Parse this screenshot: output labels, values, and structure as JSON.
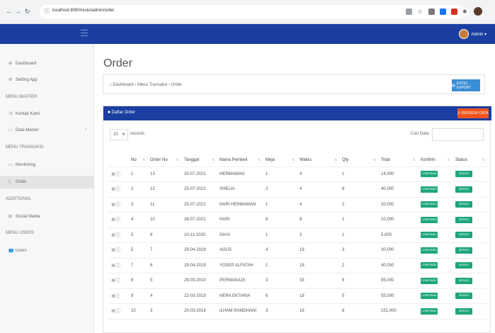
{
  "browser": {
    "url": "localhost:8080/resto/admin/order"
  },
  "header": {
    "user_label": "Admin ▾"
  },
  "sidebar": {
    "items": [
      {
        "label": "Dashboard",
        "icon": "dashboard-icon",
        "glyph": "⊕"
      },
      {
        "label": "Setting App",
        "icon": "gear-icon",
        "glyph": "⚙"
      }
    ],
    "master_heading": "MENU MASTER",
    "master_items": [
      {
        "label": "Kontak Kami",
        "icon": "phone-icon",
        "glyph": "☏"
      },
      {
        "label": "Data Master",
        "icon": "folder-icon",
        "glyph": "▭",
        "chevron": "‹"
      }
    ],
    "transaksi_heading": "MENU TRANSAKSI",
    "transaksi_items": [
      {
        "label": "Monitoring",
        "icon": "monitor-icon",
        "glyph": "▭"
      },
      {
        "label": "Order",
        "icon": "order-icon",
        "glyph": "▯"
      }
    ],
    "additional_heading": "ADDITIONAL",
    "additional_items": [
      {
        "label": "Sosial Media",
        "icon": "share-icon",
        "glyph": "⊞"
      }
    ],
    "users_heading": "MENU USERS",
    "users_items": [
      {
        "label": "Users",
        "icon": "users-icon",
        "glyph": "👥"
      }
    ]
  },
  "main": {
    "title": "Order",
    "breadcrumb": "⌂ Dashboard  ›  Menu Transaksi  ›  Order",
    "excel_button": "EXCEL EXPORT",
    "card_title": "Daftar Order",
    "refresh_button": "REFRESH DATA",
    "length_value": "10",
    "length_label": "records",
    "search_label": "Cari Data :"
  },
  "table": {
    "columns": [
      "",
      "No",
      "Order No",
      "Tanggal",
      "Nama Pembeli",
      "Meja",
      "Waktu",
      "Qty",
      "Total",
      "Konfirm",
      "Status"
    ],
    "rows": [
      {
        "no": "1",
        "order": "13",
        "tanggal": "20-07-2021",
        "nama": "HERMAWAN",
        "meja": "1",
        "waktu": "4",
        "qty": "1",
        "total": "14,000"
      },
      {
        "no": "2",
        "order": "12",
        "tanggal": "25-07-2021",
        "nama": "SHELIA",
        "meja": "2",
        "waktu": "4",
        "qty": "8",
        "total": "40,000"
      },
      {
        "no": "3",
        "order": "11",
        "tanggal": "25-07-2021",
        "nama": "HARI HERMAWAN",
        "meja": "1",
        "waktu": "4",
        "qty": "2",
        "total": "20,000"
      },
      {
        "no": "4",
        "order": "10",
        "tanggal": "26-07-2021",
        "nama": "HARI",
        "meja": "8",
        "waktu": "8",
        "qty": "1",
        "total": "10,000"
      },
      {
        "no": "5",
        "order": "8",
        "tanggal": "10-11-2020",
        "nama": "SAYA",
        "meja": "1",
        "waktu": "2",
        "qty": "1",
        "total": "5,000"
      },
      {
        "no": "5",
        "order": "7",
        "tanggal": "29-04-2019",
        "nama": "AGUS",
        "meja": "4",
        "waktu": "18",
        "qty": "3",
        "total": "30,000"
      },
      {
        "no": "7",
        "order": "6",
        "tanggal": "29-04-2019",
        "nama": "YOSEP ALFATAH",
        "meja": "1",
        "waktu": "18",
        "qty": "2",
        "total": "40,000"
      },
      {
        "no": "8",
        "order": "5",
        "tanggal": "29-03-2019",
        "nama": "PERMANA15",
        "meja": "3",
        "waktu": "33",
        "qty": "6",
        "total": "95,000"
      },
      {
        "no": "9",
        "order": "4",
        "tanggal": "22-03-2019",
        "nama": "HERA EKTARIA",
        "meja": "6",
        "waktu": "18",
        "qty": "5",
        "total": "55,000"
      },
      {
        "no": "10",
        "order": "3",
        "tanggal": "20-03-2019",
        "nama": "ILHAM RAMDHANI",
        "meja": "3",
        "waktu": "18",
        "qty": "8",
        "total": "151,000"
      }
    ],
    "action_glyph": "⊕ⓘ",
    "konfirm_label": "CONFIRMED",
    "status_label": "SERVED"
  },
  "colors": {
    "primary": "#1a3fa0",
    "excel": "#3a8ed6",
    "refresh": "#f0541e",
    "badge": "#1ea67c"
  }
}
